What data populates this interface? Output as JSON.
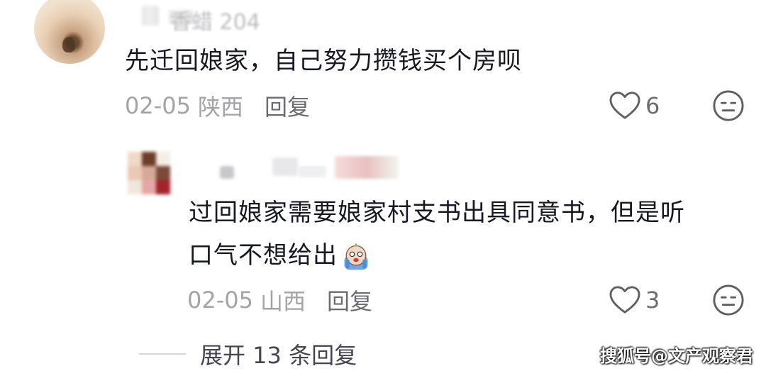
{
  "comments": [
    {
      "text": "先迁回娘家，自己努力攒钱买个房呗",
      "date": "02-05",
      "region": "陕西",
      "reply_label": "回复",
      "likes": "6"
    },
    {
      "text_line1": "过回娘家需要娘家村支书出具同意书，但是听",
      "text_line2": "口气不想给出",
      "emoji": "crying-emoji",
      "date": "02-05",
      "region": "山西",
      "reply_label": "回复",
      "likes": "3"
    }
  ],
  "blurred_username": "香蜡 204",
  "expand": {
    "label": "展开 13 条回复"
  },
  "watermark": "搜狐号@文产观察君",
  "icons": [
    "heart-outline-icon",
    "dislike-face-icon",
    "crying-emoji"
  ]
}
